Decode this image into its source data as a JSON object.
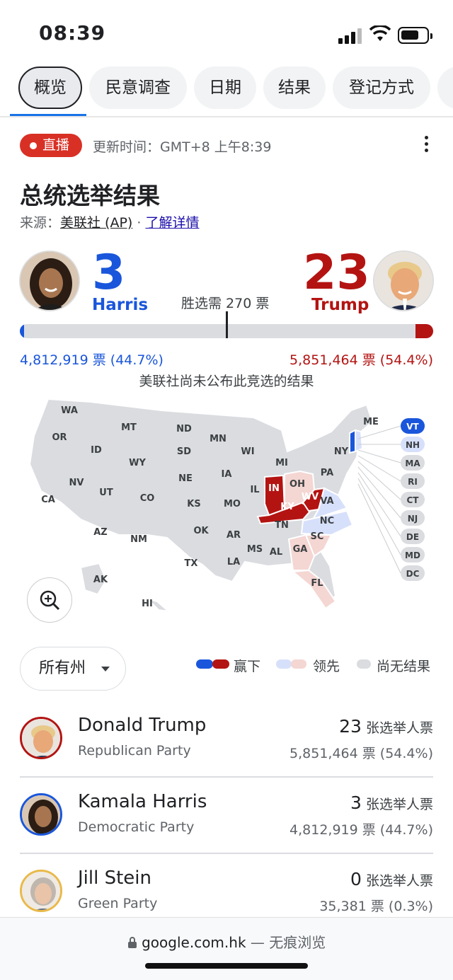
{
  "status_bar": {
    "time": "08:39"
  },
  "tabs": [
    {
      "label": "概览",
      "active": true
    },
    {
      "label": "民意调查"
    },
    {
      "label": "日期"
    },
    {
      "label": "结果"
    },
    {
      "label": "登记方式"
    }
  ],
  "live_badge": "直播",
  "updated": "更新时间：GMT+8 上午8:39",
  "title": "总统选举结果",
  "source": {
    "prefix": "来源：",
    "name": "美联社 (AP)",
    "sep": " · ",
    "link": "了解详情"
  },
  "harris": {
    "ev": "3",
    "name": "Harris",
    "votes": "4,812,919 票 (44.7%)",
    "color": "#1a56db",
    "ev_fraction": 0.0056
  },
  "trump": {
    "ev": "23",
    "name": "Trump",
    "votes": "5,851,464 票 (54.4%)",
    "color": "#b31412",
    "ev_fraction": 0.043
  },
  "needed": "胜选需 270 票",
  "ap_note": "美联社尚未公布此竞选的结果",
  "map": {
    "labels": [
      "WA",
      "MT",
      "ND",
      "OR",
      "MN",
      "ID",
      "SD",
      "WI",
      "WY",
      "MI",
      "NY",
      "ME",
      "NE",
      "IA",
      "PA",
      "OH",
      "IN",
      "NV",
      "UT",
      "CO",
      "IL",
      "KS",
      "MO",
      "WV",
      "VA",
      "CA",
      "KY",
      "AZ",
      "OK",
      "NM",
      "AR",
      "TN",
      "NC",
      "SC",
      "MS",
      "AL",
      "GA",
      "TX",
      "LA",
      "FL",
      "AK",
      "HI"
    ],
    "east_labels": [
      "VT",
      "NH",
      "MA",
      "RI",
      "CT",
      "NJ",
      "DE",
      "MD",
      "DC"
    ],
    "won_trump": [
      "IN",
      "KY",
      "WV"
    ],
    "won_harris": [
      "VT"
    ],
    "lead_trump": [
      "OH",
      "SC",
      "GA",
      "FL"
    ],
    "lead_harris": [
      "VA",
      "NC"
    ]
  },
  "filter": "所有州",
  "legend": {
    "won": "赢下",
    "leading": "领先",
    "no_result": "尚无结果"
  },
  "candidates": [
    {
      "name": "Donald Trump",
      "party": "Republican Party",
      "ev": "23",
      "ev_label": " 张选举人票",
      "votes": "5,851,464 票 (54.4%)"
    },
    {
      "name": "Kamala Harris",
      "party": "Democratic Party",
      "ev": "3",
      "ev_label": " 张选举人票",
      "votes": "4,812,919 票 (44.7%)"
    },
    {
      "name": "Jill Stein",
      "party": "Green Party",
      "ev": "0",
      "ev_label": " 张选举人票",
      "votes": "35,381 票 (0.3%)"
    }
  ],
  "browser": {
    "url": "google.com.hk",
    "mode": " — 无痕浏览"
  }
}
